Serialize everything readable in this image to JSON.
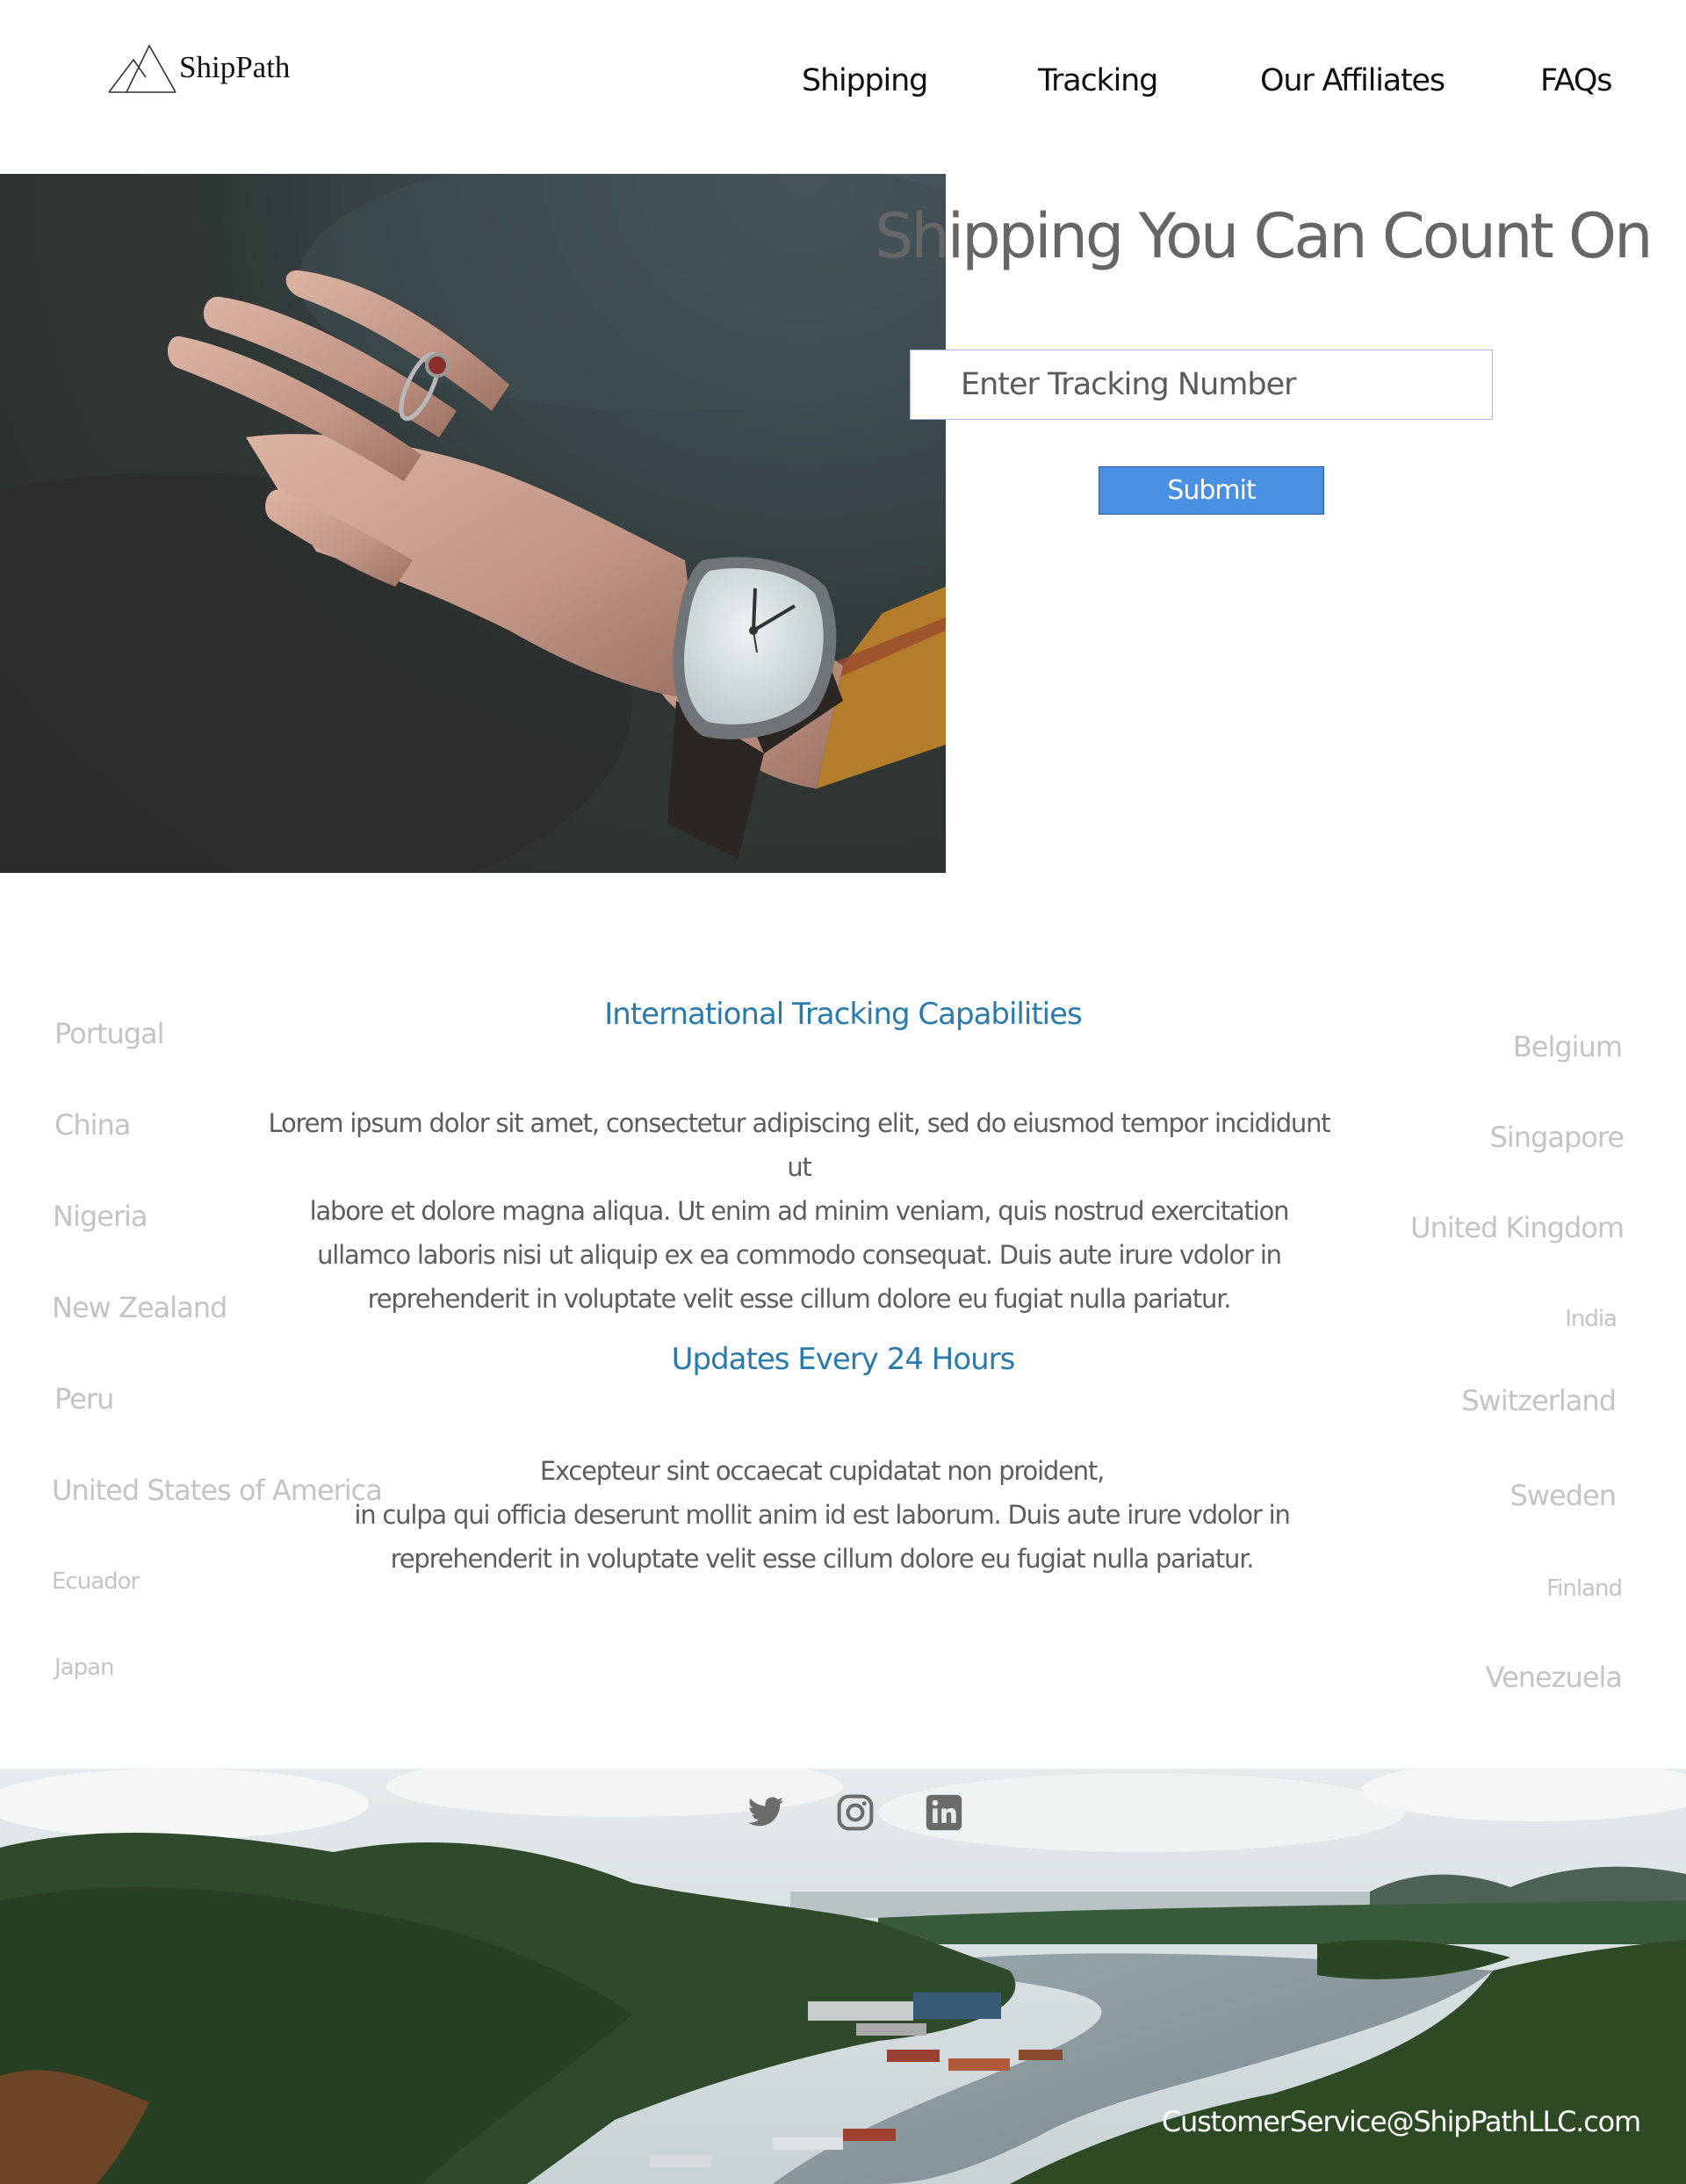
{
  "header": {
    "logo_text": "ShipPath",
    "nav": [
      "Shipping",
      "Tracking",
      "Our Affiliates",
      "FAQs"
    ]
  },
  "hero": {
    "title": "Shipping You Can Count On",
    "tracking_placeholder": "Enter Tracking Number",
    "submit_label": "Submit"
  },
  "sections": [
    {
      "heading": "International Tracking Capabilities",
      "body_lines": [
        "Lorem ipsum dolor sit amet, consectetur adipiscing elit, sed do eiusmod tempor incididunt ut",
        "labore et dolore magna aliqua. Ut enim ad minim veniam, quis nostrud exercitation",
        "ullamco laboris nisi ut aliquip ex ea commodo consequat. Duis aute irure vdolor in",
        "reprehenderit in voluptate velit esse cillum dolore eu fugiat nulla pariatur."
      ]
    },
    {
      "heading": "Updates Every 24 Hours",
      "body_lines": [
        "Excepteur sint occaecat cupidatat non proident,",
        "in culpa qui officia deserunt mollit anim id est laborum. Duis aute irure vdolor in",
        "reprehenderit in voluptate velit esse cillum dolore eu fugiat nulla pariatur."
      ]
    }
  ],
  "countries_left": [
    "Portugal",
    "China",
    "Nigeria",
    "New Zealand",
    "Peru",
    "United States of America",
    "Ecuador",
    "Japan"
  ],
  "countries_right": [
    "Belgium",
    "Singapore",
    "United Kingdom",
    "India",
    "Switzerland",
    "Sweden",
    "Finland",
    "Venezuela"
  ],
  "footer": {
    "social_icons": [
      "twitter-icon",
      "instagram-icon",
      "linkedin-icon"
    ],
    "email": "CustomerService@ShipPathLLC.com"
  },
  "colors": {
    "accent_heading": "#2a7bab",
    "submit_button": "#4a90e2",
    "nav_text": "#111111",
    "country_text": "#c4c4c4"
  }
}
